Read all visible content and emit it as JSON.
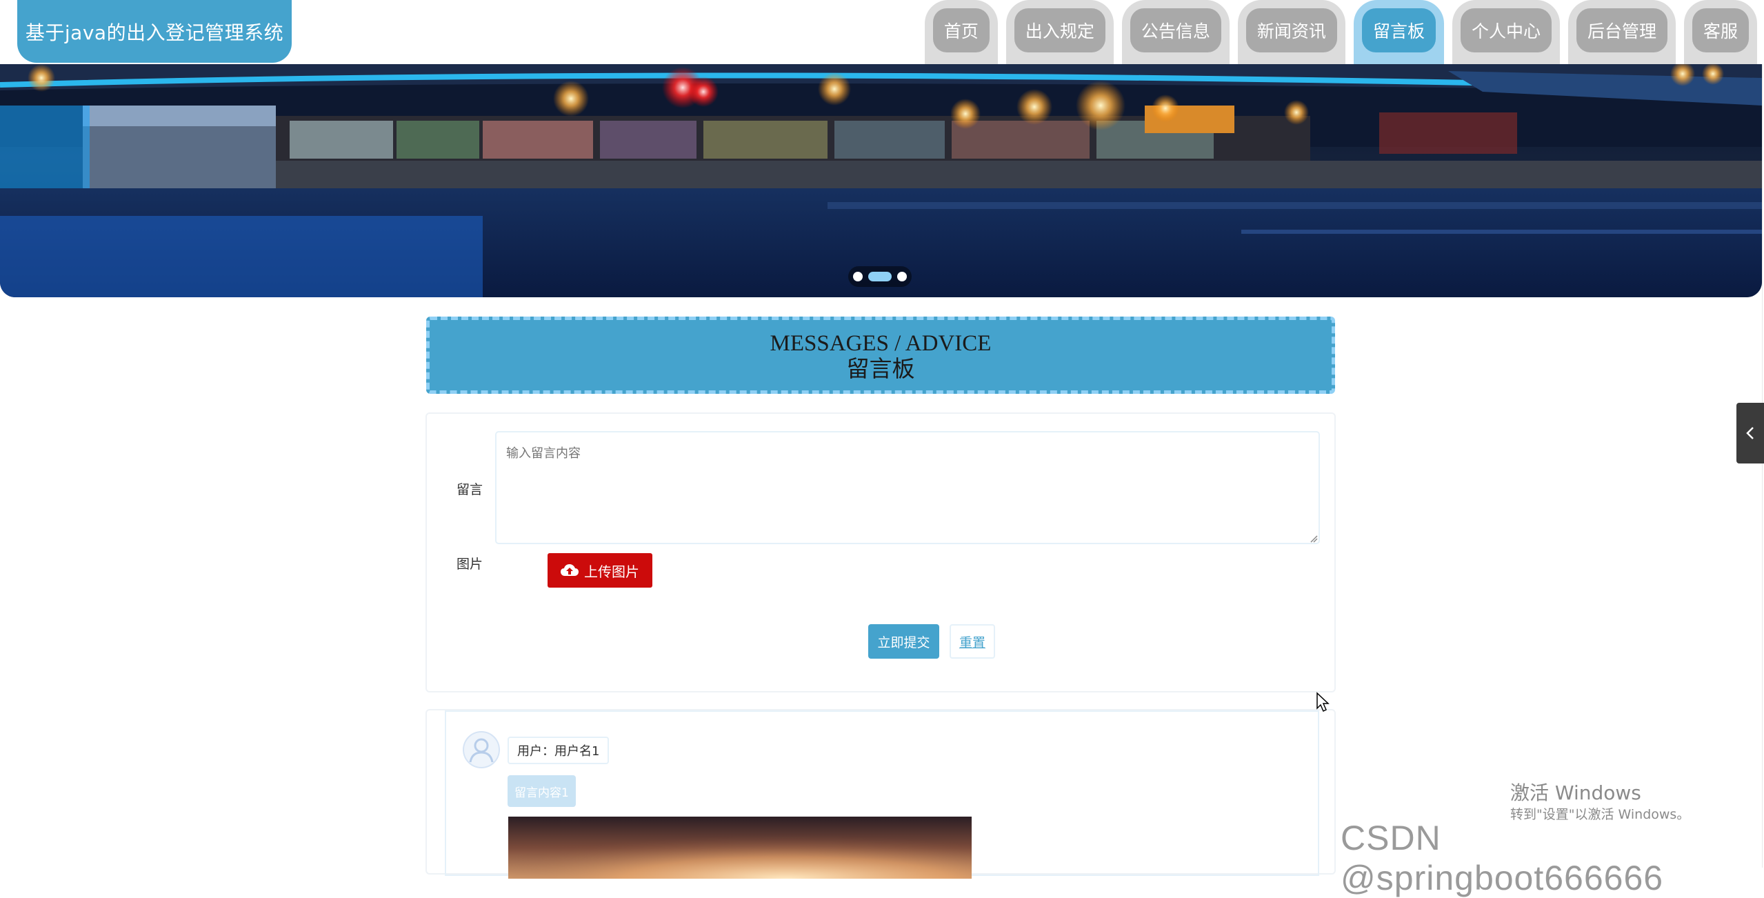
{
  "header": {
    "site_title": "基于java的出入登记管理系统",
    "nav": [
      {
        "label": "首页",
        "active": false
      },
      {
        "label": "出入规定",
        "active": false
      },
      {
        "label": "公告信息",
        "active": false
      },
      {
        "label": "新闻资讯",
        "active": false
      },
      {
        "label": "留言板",
        "active": true
      },
      {
        "label": "个人中心",
        "active": false
      },
      {
        "label": "后台管理",
        "active": false
      },
      {
        "label": "客服",
        "active": false
      }
    ]
  },
  "banner": {
    "slide_count": 3,
    "active_slide": 2
  },
  "section": {
    "title_en": "MESSAGES / ADVICE",
    "title_cn": "留言板"
  },
  "form": {
    "message_label": "留言",
    "message_placeholder": "输入留言内容",
    "image_label": "图片",
    "upload_label": "上传图片",
    "submit_label": "立即提交",
    "reset_label": "重置"
  },
  "messages": [
    {
      "user_text": "用户：用户名1",
      "content": "留言内容1"
    }
  ],
  "watermarks": {
    "windows_line1": "激活 Windows",
    "windows_line2": "转到\"设置\"以激活 Windows。",
    "csdn": "CSDN @springboot666666"
  },
  "colors": {
    "primary": "#45a3cd",
    "primary_light": "#8fd0f5",
    "nav_inactive": "#a9a9a9",
    "upload_red": "#cc0b0b"
  },
  "icons": {
    "upload": "cloud-upload-icon",
    "avatar": "user-avatar-icon",
    "side_tab": "chevron-left-icon"
  }
}
